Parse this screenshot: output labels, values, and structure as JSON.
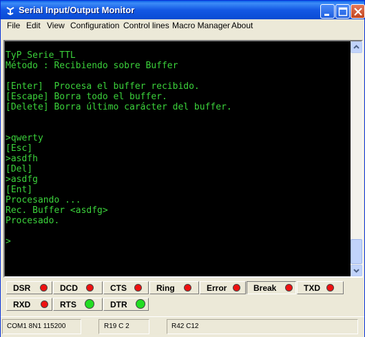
{
  "window": {
    "title": "Serial Input/Output Monitor"
  },
  "titlebar_buttons": {
    "minimize": "minimize-icon",
    "maximize": "maximize-icon",
    "close": "close-icon"
  },
  "menu": [
    "File",
    "Edit",
    "View",
    "Configuration",
    "Control lines",
    "Macro Manager",
    "About"
  ],
  "terminal": {
    "text_color": "#3bd23b",
    "background": "#000000",
    "lines": [
      "TyP_Serie_TTL",
      "Método : Recibiendo sobre Buffer",
      "",
      "[Enter]  Procesa el buffer recibido.",
      "[Escape] Borra todo el buffer.",
      "[Delete] Borra último carácter del buffer.",
      "",
      "",
      ">qwerty",
      "[Esc]",
      ">asdfh",
      "[Del]",
      ">asdfg",
      "[Ent]",
      "Procesando ...",
      "Rec. Buffer <asdfg>",
      "Procesado.",
      "",
      ">"
    ]
  },
  "indicators": [
    {
      "label": "DSR",
      "state": "red"
    },
    {
      "label": "DCD",
      "state": "red"
    },
    {
      "label": "CTS",
      "state": "red"
    },
    {
      "label": "Ring",
      "state": "red"
    },
    {
      "label": "Error",
      "state": "red"
    },
    {
      "label": "Break",
      "state": "red"
    },
    {
      "label": "TXD",
      "state": "red"
    },
    {
      "label": "RXD",
      "state": "red"
    },
    {
      "label": "RTS",
      "state": "green"
    },
    {
      "label": "DTR",
      "state": "green"
    }
  ],
  "led_colors": {
    "red": "#ee1111",
    "green": "#22dd22"
  },
  "status": {
    "port": "COM1 8N1 115200",
    "cursor": "R19 C 2",
    "size": "R42 C12"
  }
}
